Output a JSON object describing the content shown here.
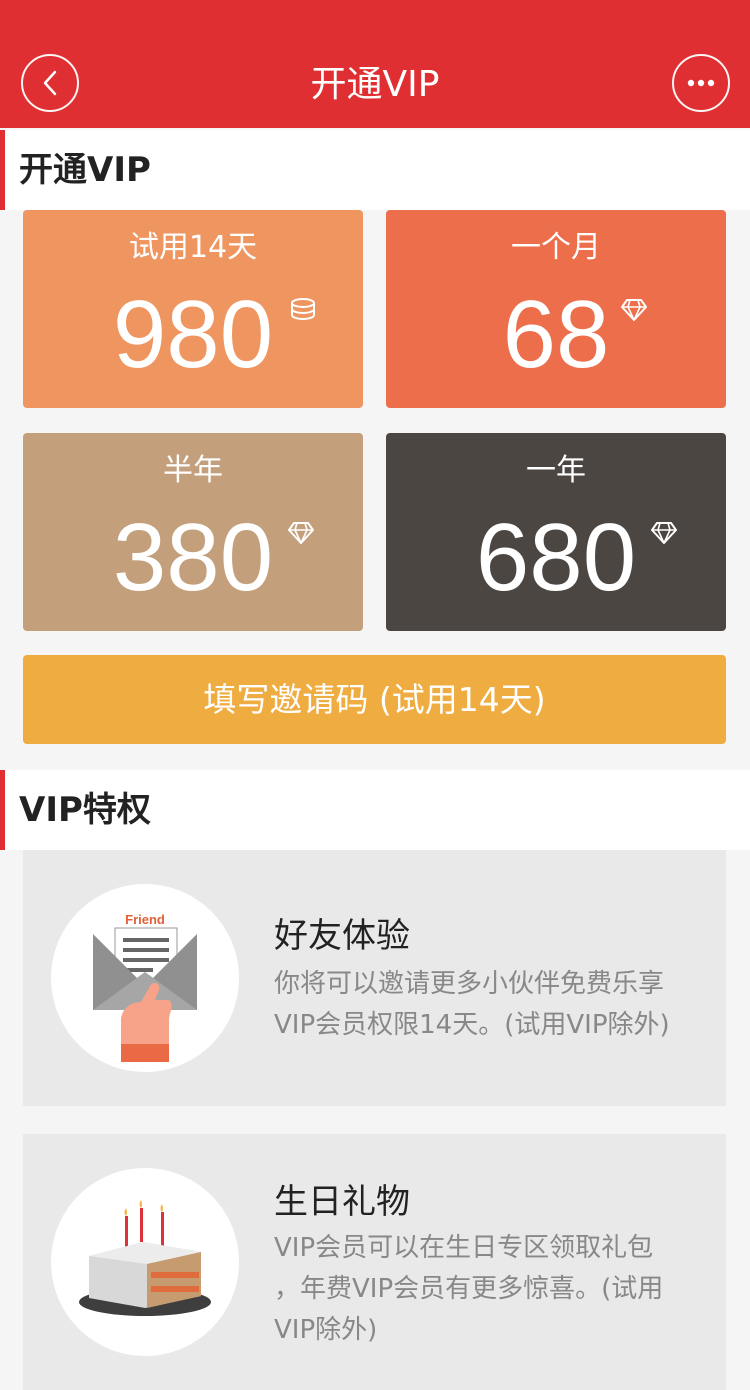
{
  "nav": {
    "title": "开通VIP"
  },
  "open_section": {
    "title": "开通VIP"
  },
  "plans": [
    {
      "label": "试用14天",
      "price": "980",
      "icon": "coins-icon",
      "color": "#ef9560"
    },
    {
      "label": "一个月",
      "price": "68",
      "icon": "diamond-icon",
      "color": "#ec6e4a"
    },
    {
      "label": "半年",
      "price": "380",
      "icon": "diamond-icon",
      "color": "#c3a07b"
    },
    {
      "label": "一年",
      "price": "680",
      "icon": "diamond-icon",
      "color": "#4c4642"
    }
  ],
  "invite": {
    "label": "填写邀请码 (试用14天)"
  },
  "privilege_section": {
    "title": "VIP特权"
  },
  "features": [
    {
      "title": "好友体验",
      "desc_lines": [
        "你将可以邀请更多小伙伴免费乐享",
        "VIP会员权限14天。(试用VIP除外)"
      ],
      "icon": "friend-envelope-icon",
      "icon_text": "Friend"
    },
    {
      "title": "生日礼物",
      "desc_lines": [
        "VIP会员可以在生日专区领取礼包",
        "，年费VIP会员有更多惊喜。(试用",
        "VIP除外)"
      ],
      "icon": "birthday-cake-icon"
    }
  ],
  "colors": {
    "brand": "#e02f32",
    "invite": "#efac40"
  }
}
